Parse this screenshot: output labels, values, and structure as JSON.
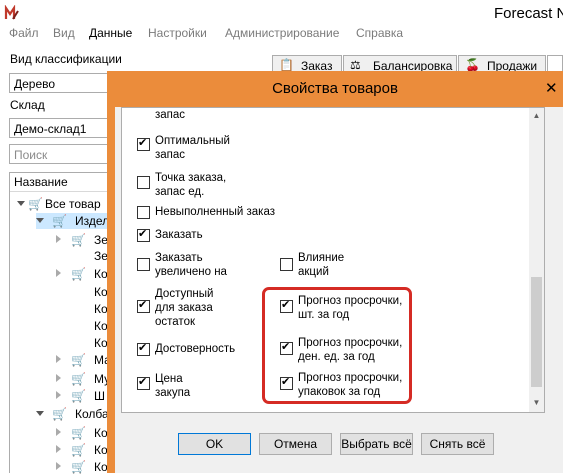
{
  "app": {
    "title": "Forecast N"
  },
  "menu": [
    {
      "label": "Файл"
    },
    {
      "label": "Вид"
    },
    {
      "label": "Данные"
    },
    {
      "label": "Настройки"
    },
    {
      "label": "Администрирование"
    },
    {
      "label": "Справка"
    }
  ],
  "left_panel": {
    "classification_label": "Вид классификации",
    "classification_value": "Дерево",
    "warehouse_label": "Склад",
    "warehouse_value": "Демо-склад1",
    "search_placeholder": "Поиск",
    "tree_header": "Название",
    "tree": [
      {
        "text": "Все товар"
      },
      {
        "text": "Издел"
      },
      {
        "text": "Зе"
      },
      {
        "text": "Зе"
      },
      {
        "text": "Ко"
      },
      {
        "text": "Ко"
      },
      {
        "text": "Ко"
      },
      {
        "text": "Ко"
      },
      {
        "text": "Ко"
      },
      {
        "text": "Ма"
      },
      {
        "text": "Му"
      },
      {
        "text": "Ш"
      },
      {
        "text": "Колба"
      },
      {
        "text": "Ко"
      },
      {
        "text": "Ко"
      },
      {
        "text": "Ко"
      }
    ]
  },
  "tabs": [
    {
      "label": "Заказ",
      "icon": "order-icon"
    },
    {
      "label": "Балансировка",
      "icon": "balance-icon"
    },
    {
      "label": "Продажи",
      "icon": "sales-icon"
    }
  ],
  "dialog": {
    "title": "Свойства товаров",
    "close_icon": "close-icon",
    "options": [
      {
        "label": "запас",
        "checked": false
      },
      {
        "label": "Оптимальный\nзапас",
        "checked": true
      },
      {
        "label": "Точка заказа,\nзапас ед.",
        "checked": false
      },
      {
        "label": "Невыполненный заказ",
        "checked": false
      },
      {
        "label": "Заказать",
        "checked": true
      },
      {
        "label": "Заказать\nувеличено на",
        "checked": false
      },
      {
        "label": "Влияние\nакций",
        "checked": false
      },
      {
        "label": "Доступный\nдля заказа\nостаток",
        "checked": true
      },
      {
        "label": "Прогноз просрочки,\nшт. за год",
        "checked": true
      },
      {
        "label": "Достоверность",
        "checked": true
      },
      {
        "label": "Прогноз просрочки,\nден. ед. за год",
        "checked": true
      },
      {
        "label": "Цена\nзакупа",
        "checked": true
      },
      {
        "label": "Прогноз просрочки,\nупаковок за год",
        "checked": true
      }
    ],
    "buttons": {
      "ok": "OK",
      "cancel": "Отмена",
      "select_all": "Выбрать всё",
      "clear_all": "Снять всё"
    },
    "accent_color": "#eb8c3b",
    "highlight_color": "#d52b24"
  }
}
